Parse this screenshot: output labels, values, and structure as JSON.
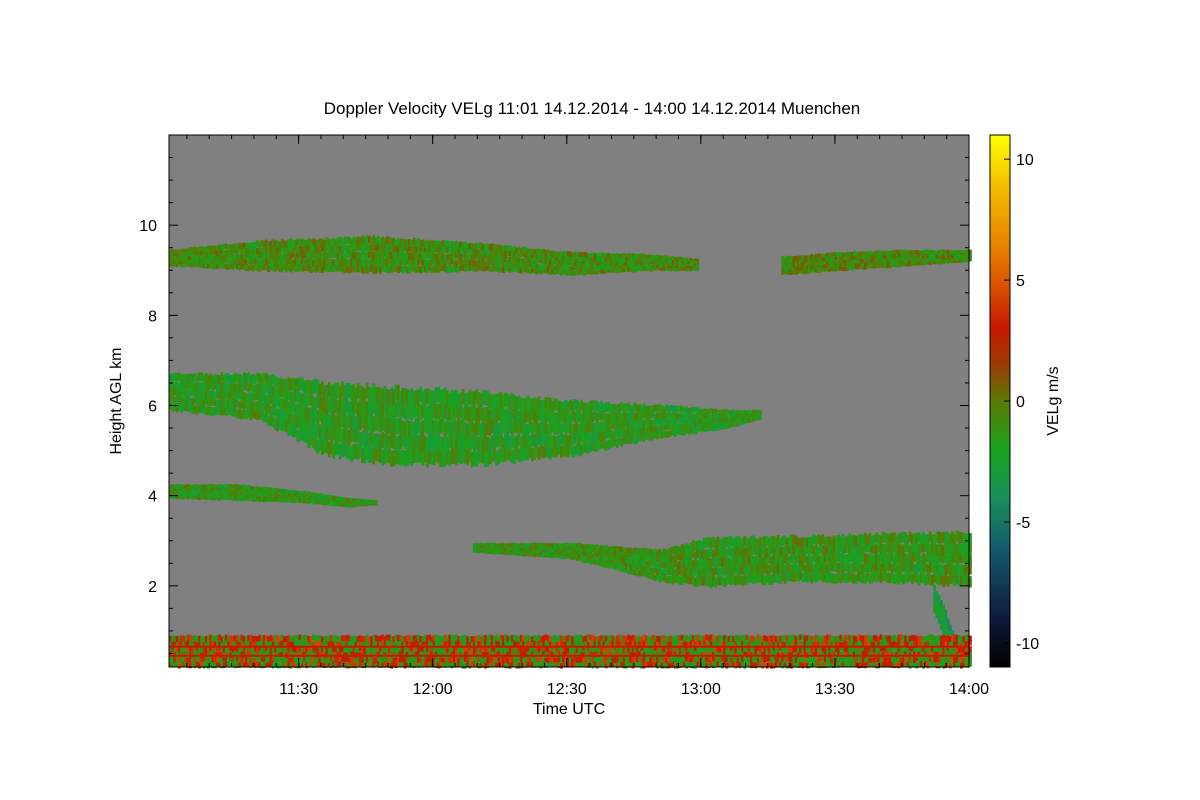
{
  "chart_data": {
    "type": "heatmap",
    "title": "Doppler Velocity VELg   11:01 14.12.2014 - 14:00 14.12.2014 Muenchen",
    "xlabel": "Time UTC",
    "ylabel": "Height AGL km",
    "colorbar_label": "VELg m/s",
    "x_range_minutes": [
      0,
      179
    ],
    "x_ticks": [
      {
        "label": "11:30",
        "minutes": 29
      },
      {
        "label": "12:00",
        "minutes": 59
      },
      {
        "label": "12:30",
        "minutes": 89
      },
      {
        "label": "13:00",
        "minutes": 119
      },
      {
        "label": "13:30",
        "minutes": 149
      },
      {
        "label": "14:00",
        "minutes": 179
      }
    ],
    "ylim": [
      0.2,
      12
    ],
    "y_ticks": [
      2,
      4,
      6,
      8,
      10
    ],
    "clim": [
      -11,
      11
    ],
    "colorbar_ticks": [
      10,
      5,
      0,
      -5,
      -10
    ],
    "background_color": "#808080",
    "colormap": [
      {
        "v": -11,
        "c": "#000000"
      },
      {
        "v": -9,
        "c": "#0d1a3a"
      },
      {
        "v": -6,
        "c": "#145c6e"
      },
      {
        "v": -4,
        "c": "#1a8f5a"
      },
      {
        "v": -2,
        "c": "#19a21e"
      },
      {
        "v": 0,
        "c": "#5a7a05"
      },
      {
        "v": 1.5,
        "c": "#9a3b05"
      },
      {
        "v": 3,
        "c": "#c81800"
      },
      {
        "v": 6,
        "c": "#e67800"
      },
      {
        "v": 8.5,
        "c": "#f2b400"
      },
      {
        "v": 11,
        "c": "#ffff00"
      }
    ],
    "layers": [
      {
        "name": "cirrus 9 km",
        "segments": [
          [
            0,
            9.1,
            9.45
          ],
          [
            20,
            9.0,
            9.65
          ],
          [
            45,
            8.95,
            9.75
          ],
          [
            70,
            9.0,
            9.6
          ],
          [
            90,
            8.9,
            9.4
          ],
          [
            108,
            9.0,
            9.35
          ],
          [
            118,
            9.0,
            9.25
          ]
        ],
        "v_mean": -0.8
      },
      {
        "name": "cirrus 9 km east",
        "segments": [
          [
            137,
            8.9,
            9.3
          ],
          [
            150,
            9.0,
            9.4
          ],
          [
            165,
            9.1,
            9.45
          ],
          [
            179,
            9.2,
            9.45
          ]
        ],
        "v_mean": -0.6
      },
      {
        "name": "altostratus 5-6 km",
        "segments": [
          [
            0,
            5.9,
            6.7
          ],
          [
            20,
            5.7,
            6.7
          ],
          [
            35,
            4.9,
            6.5
          ],
          [
            50,
            4.7,
            6.4
          ],
          [
            70,
            4.7,
            6.3
          ],
          [
            90,
            4.9,
            6.1
          ],
          [
            110,
            5.3,
            6.0
          ],
          [
            125,
            5.5,
            5.9
          ],
          [
            132,
            5.7,
            5.9
          ]
        ],
        "v_mean": -1.6
      },
      {
        "name": "layer 4 km",
        "segments": [
          [
            0,
            3.95,
            4.25
          ],
          [
            15,
            3.9,
            4.25
          ],
          [
            30,
            3.85,
            4.1
          ],
          [
            40,
            3.75,
            3.95
          ],
          [
            46,
            3.8,
            3.9
          ]
        ],
        "v_mean": -1.3
      },
      {
        "name": "low cloud 2-3 km",
        "segments": [
          [
            68,
            2.75,
            2.95
          ],
          [
            90,
            2.6,
            2.95
          ],
          [
            110,
            2.1,
            2.8
          ],
          [
            120,
            2.0,
            3.05
          ],
          [
            140,
            2.1,
            3.1
          ],
          [
            160,
            2.1,
            3.15
          ],
          [
            179,
            2.0,
            3.2
          ]
        ],
        "v_mean": -1.2
      },
      {
        "name": "fall streak",
        "segments": [
          [
            171,
            1.4,
            2.0
          ],
          [
            173,
            0.9,
            1.6
          ],
          [
            175,
            0.4,
            1.0
          ],
          [
            177,
            0.3,
            0.7
          ]
        ],
        "v_mean": -3.0
      },
      {
        "name": "boundary layer clutter",
        "segments": [
          [
            0,
            0.2,
            0.9
          ],
          [
            179,
            0.2,
            0.9
          ]
        ],
        "v_mean": 0.5
      }
    ]
  }
}
